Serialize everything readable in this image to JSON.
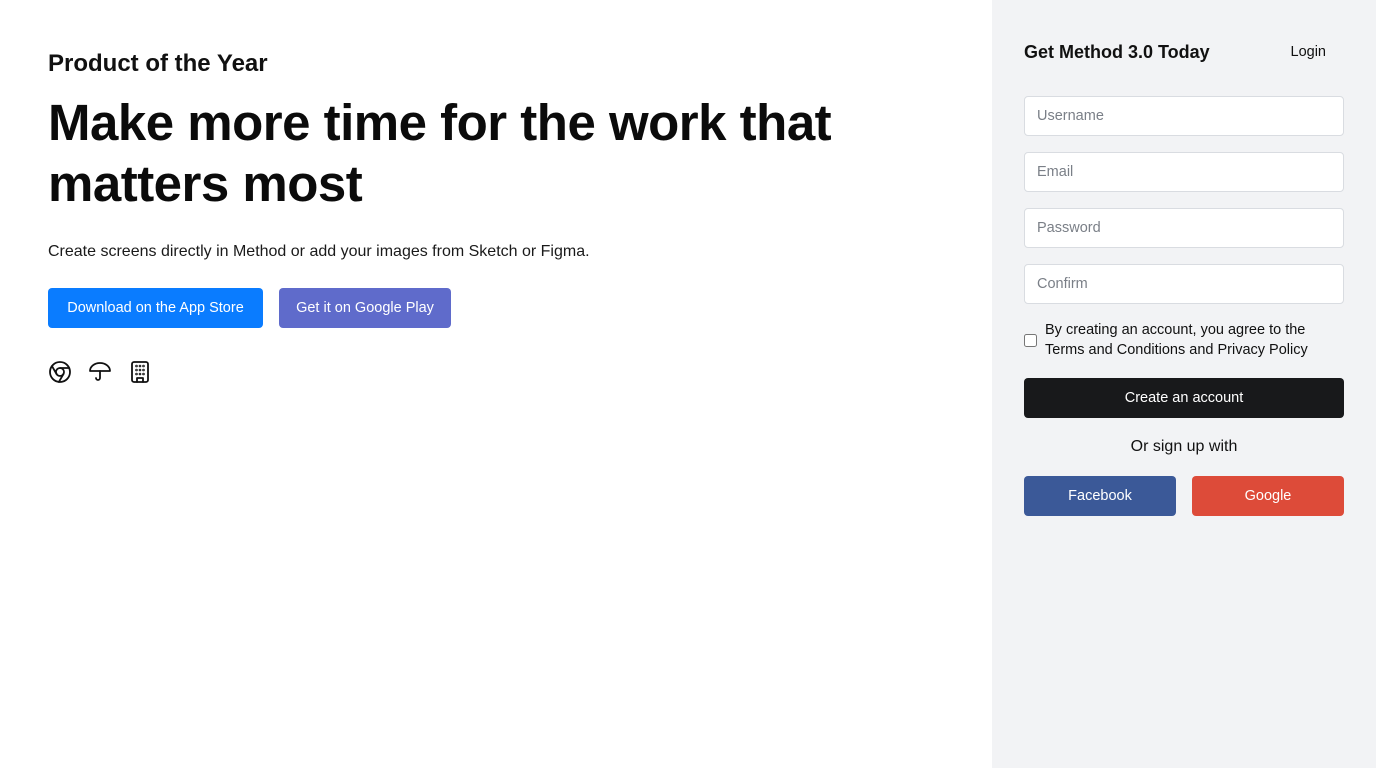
{
  "hero": {
    "eyebrow": "Product of the Year",
    "headline": "Make more time for the work that matters most",
    "subtext": "Create screens directly in Method or add your images from Sketch or Figma.",
    "buttons": {
      "app_store": "Download on the App Store",
      "google_play": "Get it on Google Play"
    },
    "icons": [
      "chrome-icon",
      "umbrella-icon",
      "building-icon"
    ]
  },
  "panel": {
    "title": "Get Method 3.0 Today",
    "login": "Login",
    "fields": {
      "username": {
        "placeholder": "Username",
        "value": ""
      },
      "email": {
        "placeholder": "Email",
        "value": ""
      },
      "password": {
        "placeholder": "Password",
        "value": ""
      },
      "confirm": {
        "placeholder": "Confirm",
        "value": ""
      }
    },
    "agree_text": "By creating an account, you agree to the Terms and Conditions and Privacy Policy",
    "create_button": "Create an account",
    "or_text": "Or sign up with",
    "social": {
      "facebook": "Facebook",
      "google": "Google"
    }
  },
  "colors": {
    "app_store_button": "#0a7cff",
    "google_play_button": "#5f6bcb",
    "create_button": "#18191b",
    "facebook_button": "#3b5998",
    "google_button": "#dd4b39",
    "panel_background": "#f2f3f5"
  }
}
